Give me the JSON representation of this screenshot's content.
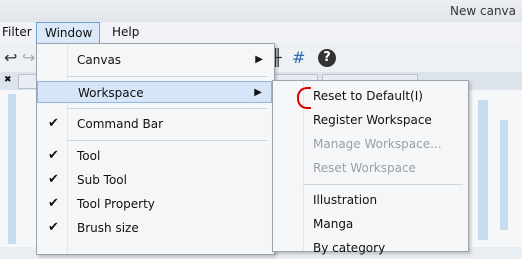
{
  "window": {
    "title": "New canva"
  },
  "menubar": {
    "items": [
      "Filter",
      "Window",
      "Help"
    ]
  },
  "dropdown": {
    "items": [
      {
        "label": "Canvas",
        "submenu": true,
        "checked": false
      },
      {
        "label": "Workspace",
        "submenu": true,
        "checked": false,
        "highlighted": true
      },
      {
        "label": "Command Bar",
        "submenu": false,
        "checked": true
      },
      {
        "label": "Tool",
        "submenu": false,
        "checked": true
      },
      {
        "label": "Sub Tool",
        "submenu": false,
        "checked": true
      },
      {
        "label": "Tool Property",
        "submenu": false,
        "checked": true
      },
      {
        "label": "Brush size",
        "submenu": false,
        "checked": true
      }
    ]
  },
  "submenu": {
    "items": [
      {
        "label": "Reset to Default(I)",
        "enabled": true
      },
      {
        "label": "Register Workspace",
        "enabled": true
      },
      {
        "label": "Manage Workspace...",
        "enabled": false
      },
      {
        "label": "Reset Workspace",
        "enabled": false
      },
      {
        "label": "Illustration",
        "enabled": true
      },
      {
        "label": "Manga",
        "enabled": true
      },
      {
        "label": "By category",
        "enabled": true
      }
    ]
  },
  "glyphs": {
    "check": "✔",
    "arrow": "▶",
    "help": "?",
    "close": "✖"
  },
  "colors": {
    "highlight": "#d6e6f8",
    "annotation": "#e00000"
  }
}
